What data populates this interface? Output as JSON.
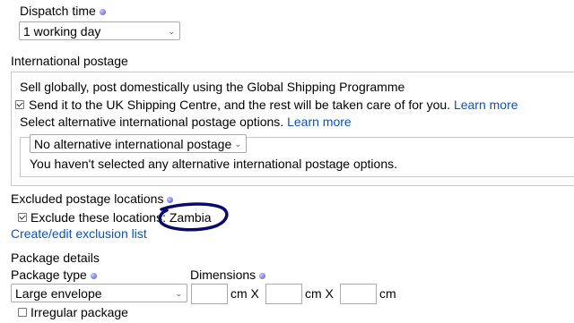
{
  "dispatch": {
    "label": "Dispatch time",
    "selected": "1 working day"
  },
  "international": {
    "label": "International postage",
    "gsp_line": "Sell globally, post domestically using the Global Shipping Programme",
    "send_checkbox_label": "Send it to the UK Shipping Centre, and the rest will be taken care of for you.",
    "learn_more_1": "Learn more",
    "select_alt_text": "Select alternative international postage options.",
    "learn_more_2": "Learn more",
    "alt_selected": "No alternative international postage",
    "alt_none_message": "You haven't selected any alternative international postage options."
  },
  "excluded": {
    "label": "Excluded postage locations",
    "checkbox_label": "Exclude these locations:",
    "locations": "Zambia",
    "edit_link": "Create/edit exclusion list",
    "annotation_color": "#0a0a6e"
  },
  "package": {
    "label": "Package details",
    "type_label": "Package type",
    "type_selected": "Large envelope",
    "dimensions_label": "Dimensions",
    "unit1": "cm X",
    "unit2": "cm X",
    "unit3": "cm",
    "length_value": "",
    "width_value": "",
    "depth_value": "",
    "irregular_label": "Irregular package"
  },
  "colors": {
    "link": "#0654ba",
    "border": "#c8c8c8"
  }
}
